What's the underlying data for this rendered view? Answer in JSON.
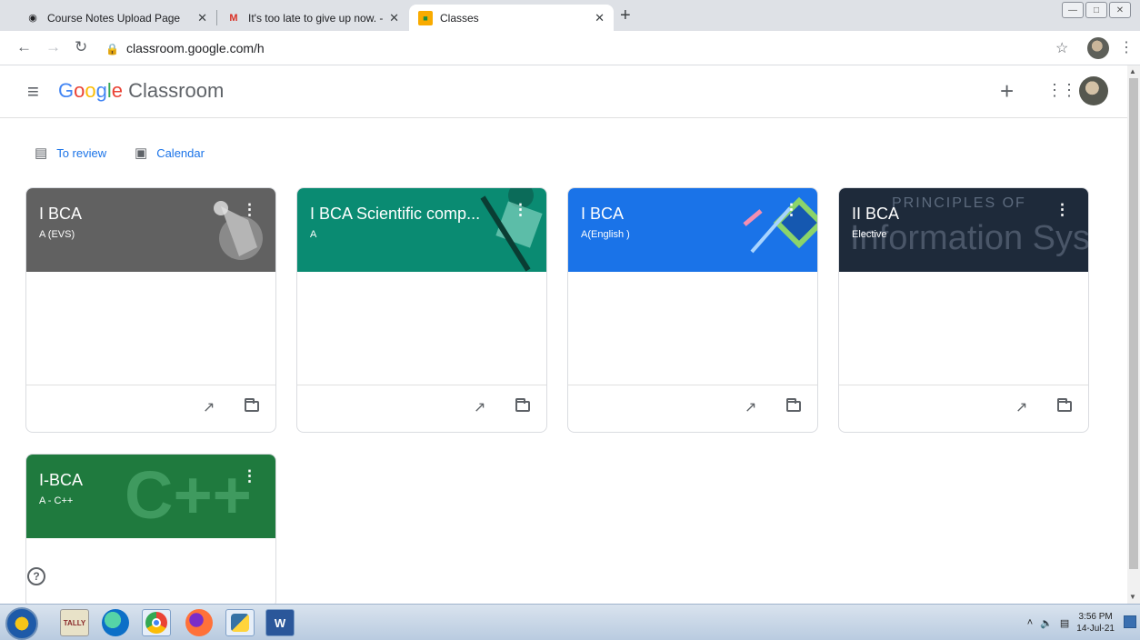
{
  "browser": {
    "tabs": [
      {
        "title": "Course Notes Upload Page",
        "icon": "globe-icon"
      },
      {
        "title": "It's too late to give up now. - mjssal",
        "icon": "gmail-icon"
      },
      {
        "title": "Classes",
        "icon": "classroom-icon",
        "active": true
      }
    ],
    "new_tab": "+",
    "url": "classroom.google.com/h"
  },
  "app": {
    "brand_google": "Google",
    "brand_product": "Classroom",
    "add_button": "+"
  },
  "quick_links": [
    {
      "label": "To review",
      "icon": "inbox-icon"
    },
    {
      "label": "Calendar",
      "icon": "calendar-icon"
    }
  ],
  "cards": [
    {
      "title": "I BCA",
      "subtitle": "A (EVS)",
      "color": "#616161"
    },
    {
      "title": "I BCA Scientific comp...",
      "subtitle": "A",
      "color": "#0a8b72"
    },
    {
      "title": "I BCA",
      "subtitle": "A(English )",
      "color": "#1a73e8"
    },
    {
      "title": "II BCA",
      "subtitle": "Elective",
      "color": "#1e2a3a",
      "banner_text_top": "PRINCIPLES OF",
      "banner_text_big": "Information Sys"
    },
    {
      "title": "I-BCA",
      "subtitle": "A - C++",
      "color": "#1f7a3e",
      "banner_text_big": "C++"
    }
  ],
  "help": "?",
  "taskbar": {
    "time": "3:56 PM",
    "date": "14-Jul-21",
    "apps": [
      "Tally ERP 9",
      "Edge",
      "Chrome",
      "Firefox",
      "Python",
      "Word"
    ]
  }
}
